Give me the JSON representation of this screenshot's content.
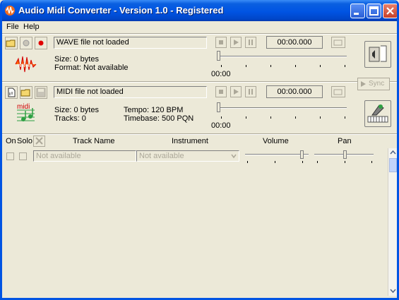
{
  "window": {
    "title": "Audio Midi Converter - Version 1.0 - Registered"
  },
  "menu": {
    "file": "File",
    "help": "Help"
  },
  "wave": {
    "filename": "WAVE file not loaded",
    "size": "Size: 0 bytes",
    "format": "Format: Not available",
    "time": "00:00.000",
    "position": "00:00",
    "logo_text": "wave"
  },
  "midi": {
    "filename": "MIDI file not loaded",
    "size": "Size: 0 bytes",
    "tracks": "Tracks: 0",
    "tempo": "Tempo: 120 BPM",
    "timebase": "Timebase: 500 PQN",
    "time": "00:00.000",
    "position": "00:00",
    "logo_text": "midi"
  },
  "sync_label": "Sync",
  "tracks_header": {
    "on": "On",
    "solo": "Solo",
    "track_name": "Track Name",
    "instrument": "Instrument",
    "volume": "Volume",
    "pan": "Pan"
  },
  "track_row": {
    "name_placeholder": "Not available",
    "instrument": "Not available",
    "volume": 0.85,
    "pan": 0.5
  },
  "colors": {
    "title_bar": "#0054e3",
    "face": "#ece9d8",
    "wave_logo": "#ff6600",
    "midi_logo_green": "#2ea043",
    "midi_logo_red": "#cc0000"
  }
}
